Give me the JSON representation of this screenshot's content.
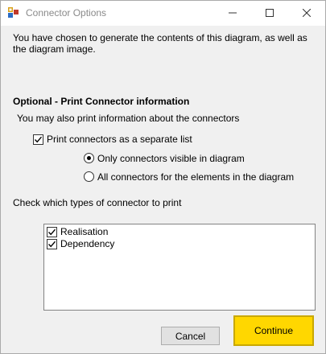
{
  "window": {
    "title": "Connector Options",
    "icon": "app-icon",
    "controls": [
      "minimize-icon",
      "maximize-icon",
      "close-icon"
    ]
  },
  "intro_text": "You have chosen to generate the contents of this diagram, as well as the diagram image.",
  "section": {
    "heading": "Optional - Print Connector information",
    "subtext": "You may also print information about the connectors"
  },
  "print_list": {
    "label": "Print connectors as a separate list",
    "checked": true
  },
  "radio_options": [
    {
      "label": "Only connectors visible in diagram",
      "selected": true
    },
    {
      "label": "All connectors for the elements in the diagram",
      "selected": false
    }
  ],
  "types_prompt": "Check which types of connector to print",
  "connector_types": [
    {
      "label": "Realisation",
      "checked": true
    },
    {
      "label": "Dependency",
      "checked": true
    }
  ],
  "buttons": {
    "cancel": "Cancel",
    "continue": "Continue"
  },
  "colors": {
    "accent_button": "#ffd700",
    "window_bg": "#f0f0f0"
  }
}
